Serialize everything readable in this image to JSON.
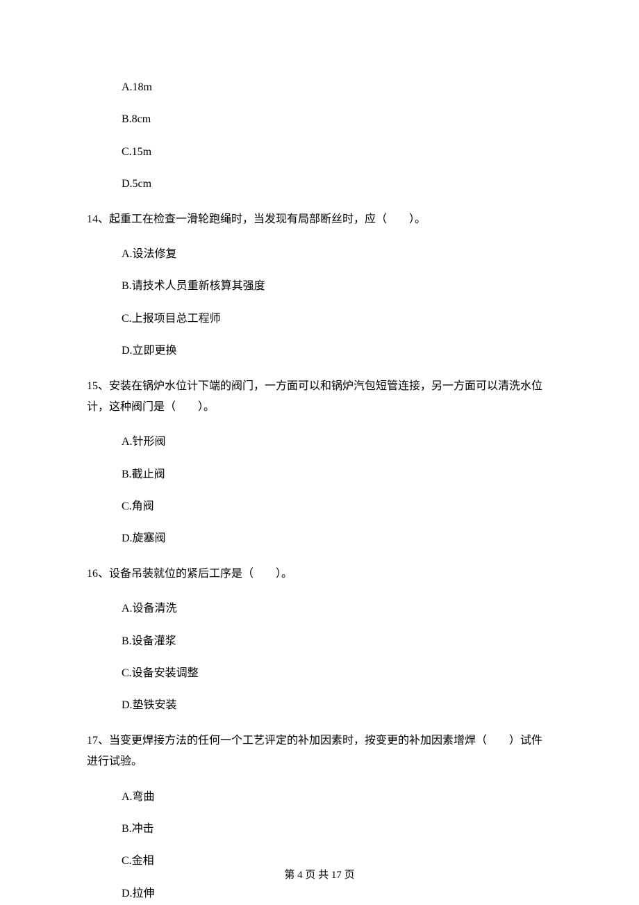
{
  "q13_options": {
    "a": "A.18m",
    "b": "B.8cm",
    "c": "C.15m",
    "d": "D.5cm"
  },
  "q14": {
    "stem": "14、起重工在检查一滑轮跑绳时，当发现有局部断丝时，应（　　）。",
    "a": "A.设法修复",
    "b": "B.请技术人员重新核算其强度",
    "c": "C.上报项目总工程师",
    "d": "D.立即更换"
  },
  "q15": {
    "stem": "15、安装在锅炉水位计下端的阀门，一方面可以和锅炉汽包短管连接，另一方面可以清洗水位计，这种阀门是（　　）。",
    "a": "A.针形阀",
    "b": "B.截止阀",
    "c": "C.角阀",
    "d": "D.旋塞阀"
  },
  "q16": {
    "stem": "16、设备吊装就位的紧后工序是（　　）。",
    "a": "A.设备清洗",
    "b": "B.设备灌浆",
    "c": "C.设备安装调整",
    "d": "D.垫铁安装"
  },
  "q17": {
    "stem": "17、当变更焊接方法的任何一个工艺评定的补加因素时，按变更的补加因素增焊（　　）试件进行试验。",
    "a": "A.弯曲",
    "b": "B.冲击",
    "c": "C.金相",
    "d": "D.拉伸"
  },
  "footer": "第 4 页 共 17 页"
}
